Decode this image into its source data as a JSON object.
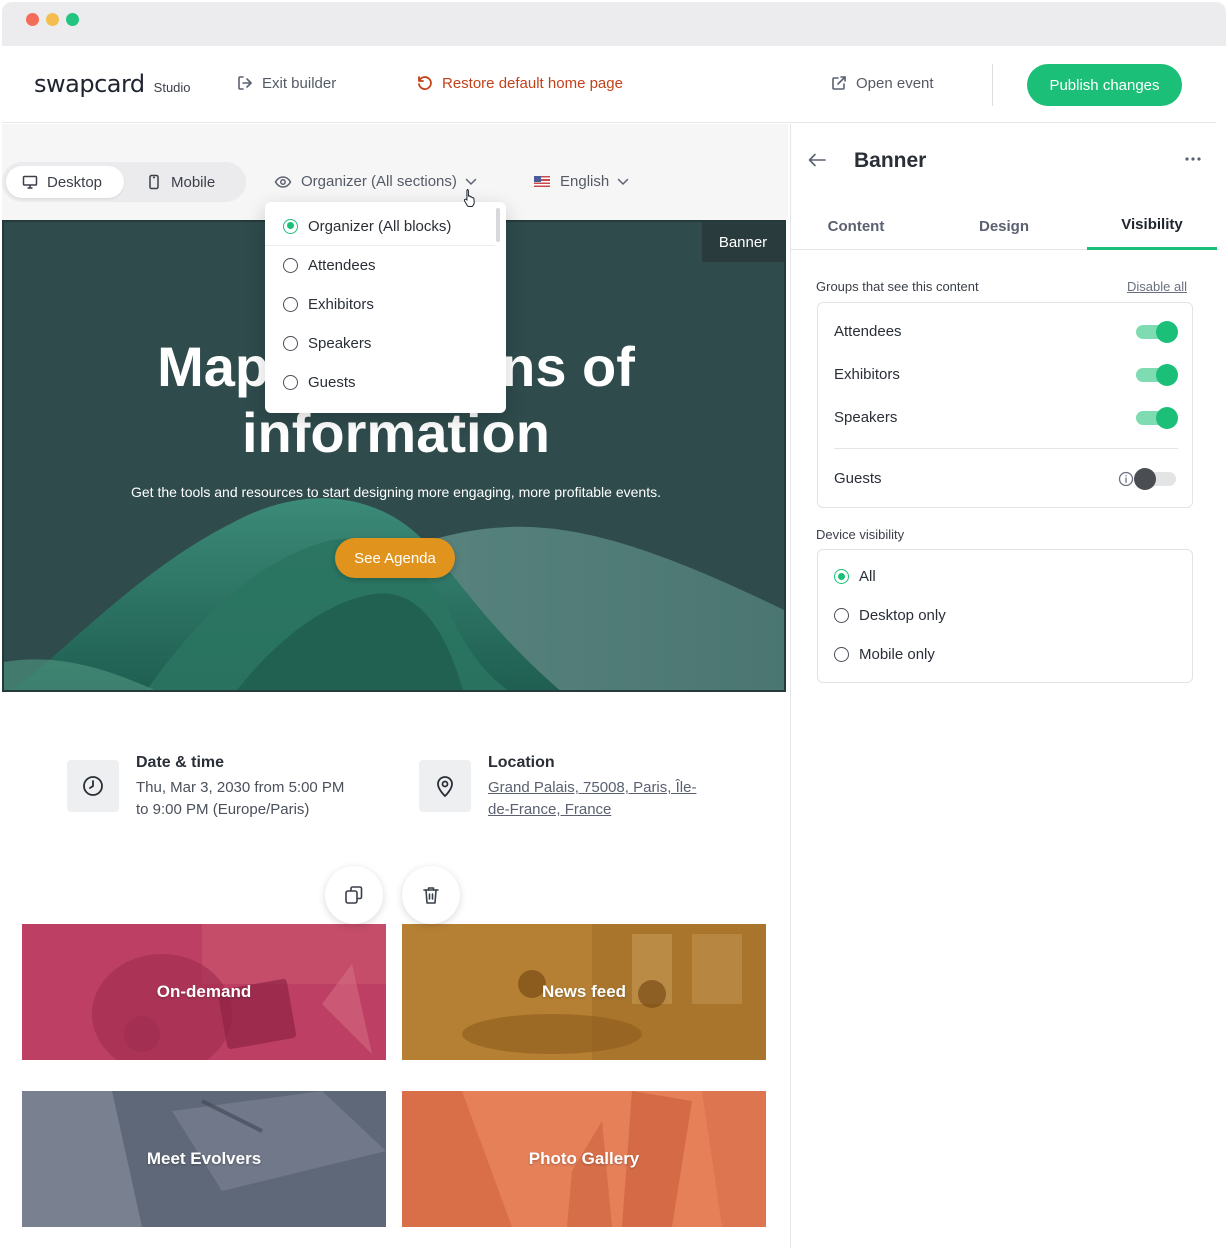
{
  "header": {
    "logo_main": "swapcard",
    "logo_sub": "Studio",
    "exit_label": "Exit builder",
    "restore_label": "Restore default home page",
    "open_label": "Open event",
    "publish_label": "Publish changes"
  },
  "toolbar": {
    "desktop_label": "Desktop",
    "mobile_label": "Mobile",
    "view_selector": "Organizer (All sections)",
    "language": "English"
  },
  "dropdown": {
    "options": [
      {
        "label": "Organizer (All blocks)",
        "selected": true
      },
      {
        "label": "Attendees",
        "selected": false
      },
      {
        "label": "Exhibitors",
        "selected": false
      },
      {
        "label": "Speakers",
        "selected": false
      },
      {
        "label": "Guests",
        "selected": false
      }
    ]
  },
  "banner": {
    "tag": "Banner",
    "headline_left": "Mapp",
    "headline_right": "rns of",
    "headline_line2": "information",
    "subtext": "Get the tools and resources to start designing more engaging, more profitable events.",
    "cta_label": "See Agenda"
  },
  "info": {
    "date_title": "Date & time",
    "date_line1": "Thu, Mar 3, 2030 from 5:00 PM",
    "date_line2": "to 9:00 PM (Europe/Paris)",
    "location_title": "Location",
    "location_line1": "Grand Palais, 75008, Paris, Île-",
    "location_line2": "de-France, France"
  },
  "cards": [
    {
      "label": "On-demand",
      "color": "#b2365c"
    },
    {
      "label": "News feed",
      "color": "#b07a2c"
    },
    {
      "label": "Meet Evolvers",
      "color": "#5a6372"
    },
    {
      "label": "Photo Gallery",
      "color": "#e27a55"
    }
  ],
  "panel": {
    "title": "Banner",
    "tabs": [
      "Content",
      "Design",
      "Visibility"
    ],
    "active_tab": "Visibility",
    "groups_label": "Groups that see this content",
    "disable_all": "Disable all",
    "groups": [
      {
        "label": "Attendees",
        "enabled": true
      },
      {
        "label": "Exhibitors",
        "enabled": true
      },
      {
        "label": "Speakers",
        "enabled": true
      },
      {
        "label": "Guests",
        "enabled": false
      }
    ],
    "device_label": "Device visibility",
    "devices": [
      {
        "label": "All",
        "selected": true
      },
      {
        "label": "Desktop only",
        "selected": false
      },
      {
        "label": "Mobile only",
        "selected": false
      }
    ]
  },
  "colors": {
    "accent": "#1cbf78",
    "restore": "#c2421a",
    "banner_bg": "#2f4b4c",
    "cta": "#e0941e"
  }
}
